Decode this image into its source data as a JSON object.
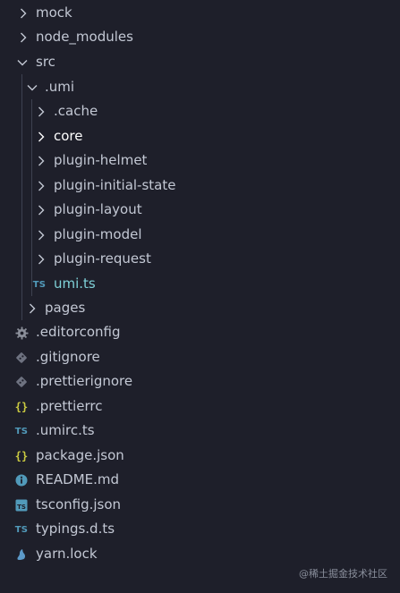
{
  "explorer": {
    "items": [
      {
        "label": "mock",
        "kind": "folder",
        "expanded": false,
        "depth": 0
      },
      {
        "label": "node_modules",
        "kind": "folder",
        "expanded": false,
        "depth": 0
      },
      {
        "label": "src",
        "kind": "folder",
        "expanded": true,
        "depth": 0
      },
      {
        "label": ".umi",
        "kind": "folder",
        "expanded": true,
        "depth": 1
      },
      {
        "label": ".cache",
        "kind": "folder",
        "expanded": false,
        "depth": 2
      },
      {
        "label": "core",
        "kind": "folder",
        "expanded": false,
        "depth": 2
      },
      {
        "label": "plugin-helmet",
        "kind": "folder",
        "expanded": false,
        "depth": 2
      },
      {
        "label": "plugin-initial-state",
        "kind": "folder",
        "expanded": false,
        "depth": 2
      },
      {
        "label": "plugin-layout",
        "kind": "folder",
        "expanded": false,
        "depth": 2
      },
      {
        "label": "plugin-model",
        "kind": "folder",
        "expanded": false,
        "depth": 2
      },
      {
        "label": "plugin-request",
        "kind": "folder",
        "expanded": false,
        "depth": 2
      },
      {
        "label": "umi.ts",
        "kind": "file",
        "icon": "typescript-icon",
        "depth": 2
      },
      {
        "label": "pages",
        "kind": "folder",
        "expanded": false,
        "depth": 1
      },
      {
        "label": ".editorconfig",
        "kind": "file",
        "icon": "gear-icon",
        "depth": 0
      },
      {
        "label": ".gitignore",
        "kind": "file",
        "icon": "git-icon",
        "depth": 0
      },
      {
        "label": ".prettierignore",
        "kind": "file",
        "icon": "git-icon",
        "depth": 0
      },
      {
        "label": ".prettierrc",
        "kind": "file",
        "icon": "json-icon",
        "depth": 0
      },
      {
        "label": ".umirc.ts",
        "kind": "file",
        "icon": "typescript-icon",
        "depth": 0
      },
      {
        "label": "package.json",
        "kind": "file",
        "icon": "json-icon",
        "depth": 0
      },
      {
        "label": "README.md",
        "kind": "file",
        "icon": "info-icon",
        "depth": 0
      },
      {
        "label": "tsconfig.json",
        "kind": "file",
        "icon": "tsconfig-icon",
        "depth": 0
      },
      {
        "label": "typings.d.ts",
        "kind": "file",
        "icon": "typescript-icon",
        "depth": 0
      },
      {
        "label": "yarn.lock",
        "kind": "file",
        "icon": "yarn-icon",
        "depth": 0
      }
    ],
    "active_item": "core"
  },
  "icon_glyphs": {
    "typescript": "TS",
    "json": "{}"
  },
  "colors": {
    "background": "#1e1f2a",
    "text": "#c3c8d4",
    "active_text": "#ffffff",
    "ts_file_text": "#7fd1d8",
    "ts_icon": "#519aba",
    "json_icon": "#cbcb41",
    "guide": "#3d4150"
  },
  "watermark": "@稀土掘金技术社区"
}
